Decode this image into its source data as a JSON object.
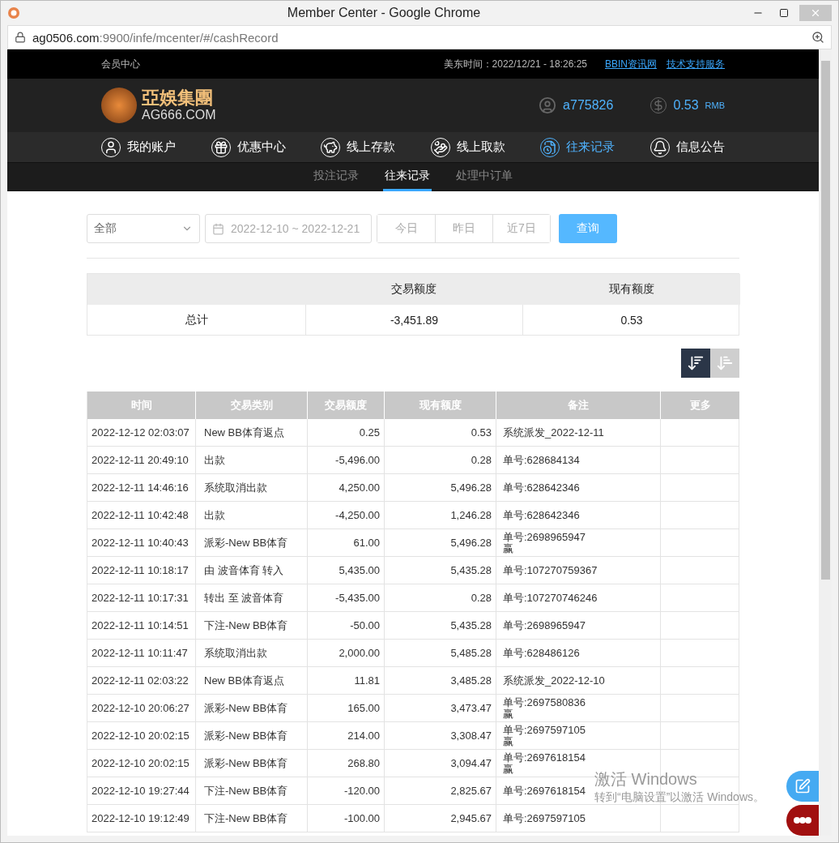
{
  "window": {
    "title": "Member Center - Google Chrome",
    "url_host": "ag0506.com",
    "url_rest": ":9900/infe/mcenter/#/cashRecord"
  },
  "topbar": {
    "label": "会员中心",
    "time": "美东时间：2022/12/21 - 18:26:25",
    "links": [
      "BBIN资讯网",
      "技术支持服务"
    ]
  },
  "header": {
    "logo_name": "亞娛集團",
    "logo_domain": "AG666.COM",
    "username": "a775826",
    "balance": "0.53",
    "currency": "RMB"
  },
  "nav": [
    {
      "label": "我的账户",
      "selected": false
    },
    {
      "label": "优惠中心",
      "selected": false
    },
    {
      "label": "线上存款",
      "selected": false
    },
    {
      "label": "线上取款",
      "selected": false
    },
    {
      "label": "往来记录",
      "selected": true
    },
    {
      "label": "信息公告",
      "selected": false
    }
  ],
  "subtabs": [
    {
      "label": "投注记录",
      "selected": false
    },
    {
      "label": "往来记录",
      "selected": true
    },
    {
      "label": "处理中订单",
      "selected": false
    }
  ],
  "filters": {
    "type_select": "全部",
    "date_range": "2022-12-10 ~ 2022-12-21",
    "quick": [
      "今日",
      "昨日",
      "近7日"
    ],
    "query_button": "查询"
  },
  "summary": {
    "columns": [
      "交易额度",
      "现有额度"
    ],
    "row_label": "总计",
    "values": [
      "-3,451.89",
      "0.53"
    ]
  },
  "sort_buttons": [
    {
      "selected": true
    },
    {
      "selected": false
    }
  ],
  "table": {
    "columns": [
      "时间",
      "交易类别",
      "交易额度",
      "现有额度",
      "备注",
      "更多"
    ],
    "rows": [
      [
        "2022-12-12 02:03:07",
        "New BB体育返点",
        "0.25",
        "0.53",
        [
          "系统派发_2022-12-11"
        ]
      ],
      [
        "2022-12-11 20:49:10",
        "出款",
        "-5,496.00",
        "0.28",
        [
          "单号:628684134"
        ]
      ],
      [
        "2022-12-11 14:46:16",
        "系统取消出款",
        "4,250.00",
        "5,496.28",
        [
          "单号:628642346"
        ]
      ],
      [
        "2022-12-11 10:42:48",
        "出款",
        "-4,250.00",
        "1,246.28",
        [
          "单号:628642346"
        ]
      ],
      [
        "2022-12-11 10:40:43",
        "派彩-New BB体育",
        "61.00",
        "5,496.28",
        [
          "单号:2698965947",
          "赢"
        ]
      ],
      [
        "2022-12-11 10:18:17",
        "由 波音体育 转入",
        "5,435.00",
        "5,435.28",
        [
          "单号:107270759367"
        ]
      ],
      [
        "2022-12-11 10:17:31",
        "转出 至 波音体育",
        "-5,435.00",
        "0.28",
        [
          "单号:107270746246"
        ]
      ],
      [
        "2022-12-11 10:14:51",
        "下注-New BB体育",
        "-50.00",
        "5,435.28",
        [
          "单号:2698965947"
        ]
      ],
      [
        "2022-12-11 10:11:47",
        "系统取消出款",
        "2,000.00",
        "5,485.28",
        [
          "单号:628486126"
        ]
      ],
      [
        "2022-12-11 02:03:22",
        "New BB体育返点",
        "11.81",
        "3,485.28",
        [
          "系统派发_2022-12-10"
        ]
      ],
      [
        "2022-12-10 20:06:27",
        "派彩-New BB体育",
        "165.00",
        "3,473.47",
        [
          "单号:2697580836",
          "赢"
        ]
      ],
      [
        "2022-12-10 20:02:15",
        "派彩-New BB体育",
        "214.00",
        "3,308.47",
        [
          "单号:2697597105",
          "赢"
        ]
      ],
      [
        "2022-12-10 20:02:15",
        "派彩-New BB体育",
        "268.80",
        "3,094.47",
        [
          "单号:2697618154",
          "赢"
        ]
      ],
      [
        "2022-12-10 19:27:44",
        "下注-New BB体育",
        "-120.00",
        "2,825.67",
        [
          "单号:2697618154"
        ]
      ],
      [
        "2022-12-10 19:12:49",
        "下注-New BB体育",
        "-100.00",
        "2,945.67",
        [
          "单号:2697597105"
        ]
      ]
    ]
  },
  "activation": {
    "title": "激活 Windows",
    "text": "转到“电脑设置”以激活 Windows。"
  }
}
